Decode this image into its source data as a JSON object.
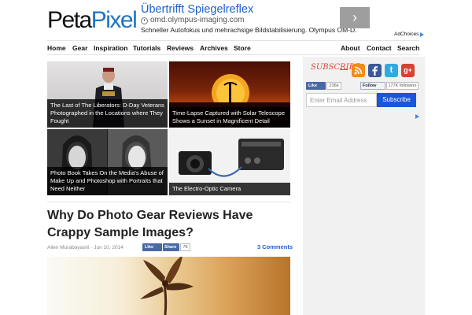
{
  "logo": {
    "peta": "Peta",
    "pixel": "Pixel"
  },
  "ad": {
    "title": "Übertrifft Spiegelreflex",
    "url": "omd.olympus-imaging.com",
    "description": "Schneller Autofokus und mehrachsige Bildstabilisierung. Olympus OM-D.",
    "arrow": "›",
    "adchoices": "AdChoices"
  },
  "nav": {
    "left": [
      "Home",
      "Gear",
      "Inspiration",
      "Tutorials",
      "Reviews",
      "Archives",
      "Store"
    ],
    "right": [
      "About",
      "Contact",
      "Search"
    ]
  },
  "featured": [
    {
      "caption": "The Last of The Liberators: D-Day Veterans Photographed in the Locations where They Fought"
    },
    {
      "caption": "Time-Lapse Captured with Solar Telescope Shows a Sunset in Magnificent Detail"
    },
    {
      "caption": "Photo Book Takes On the Media's Abuse of Make Up and Photoshop with Portraits that Need Neither"
    },
    {
      "caption": "The Electro-Optic Camera"
    }
  ],
  "article": {
    "title": "Why Do Photo Gear Reviews Have Crappy Sample Images?",
    "byline": "Allen Murabayashi · Jun 10, 2014",
    "like_label": "Like",
    "share_label": "Share",
    "like_count": "79",
    "comments": "3 Comments"
  },
  "sidebar": {
    "subscribe_label": "SUBSCRIBE",
    "social": {
      "twitter": "t",
      "googleplus": "g+"
    },
    "fb_like_label": "Like",
    "fb_count": "236k",
    "tw_follow_label": "Follow",
    "tw_count": "177K followers",
    "email_placeholder": "Enter Email Address",
    "subscribe_button": "Subscribe"
  },
  "colors": {
    "brand_blue": "#1d74c4",
    "link_blue": "#1a5fcf",
    "facebook": "#3b5998",
    "twitter": "#33a9e0",
    "rss": "#f08c1a",
    "googleplus": "#d24532",
    "subscribe_button": "#1a56db"
  }
}
